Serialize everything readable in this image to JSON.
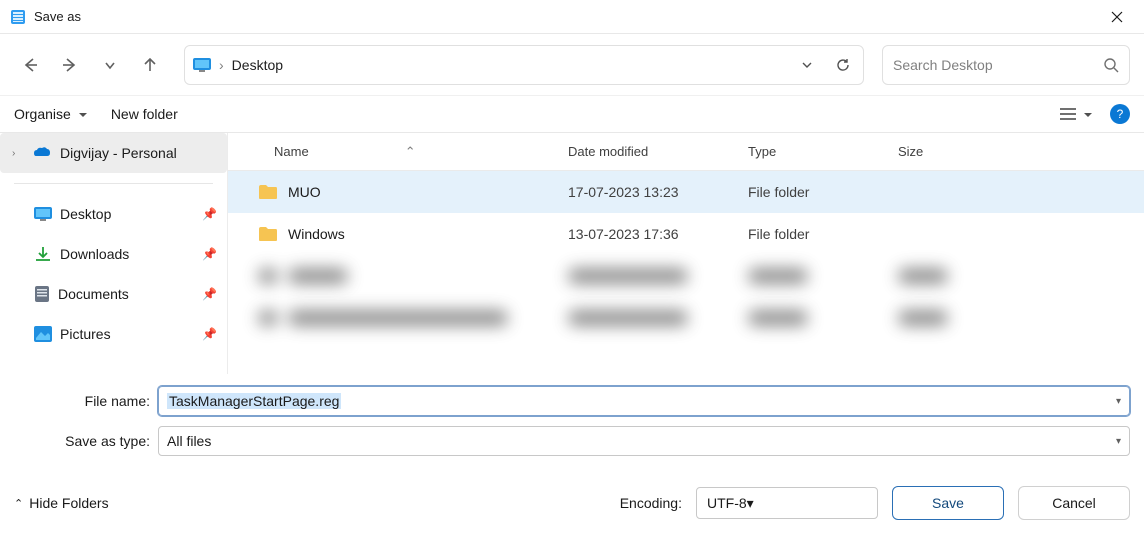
{
  "title": "Save as",
  "address": {
    "location": "Desktop"
  },
  "search": {
    "placeholder": "Search Desktop"
  },
  "toolbar": {
    "organise": "Organise",
    "newfolder": "New folder"
  },
  "sidebar": {
    "account": "Digvijay - Personal",
    "quick": [
      {
        "label": "Desktop"
      },
      {
        "label": "Downloads"
      },
      {
        "label": "Documents"
      },
      {
        "label": "Pictures"
      }
    ]
  },
  "columns": {
    "name": "Name",
    "date": "Date modified",
    "type": "Type",
    "size": "Size"
  },
  "files": [
    {
      "name": "MUO",
      "date": "17-07-2023 13:23",
      "type": "File folder"
    },
    {
      "name": "Windows",
      "date": "13-07-2023 17:36",
      "type": "File folder"
    }
  ],
  "form": {
    "filename_label": "File name:",
    "filename_value": "TaskManagerStartPage.reg",
    "type_label": "Save as type:",
    "type_value": "All files"
  },
  "footer": {
    "hide": "Hide Folders",
    "encoding_label": "Encoding:",
    "encoding_value": "UTF-8",
    "save": "Save",
    "cancel": "Cancel"
  }
}
